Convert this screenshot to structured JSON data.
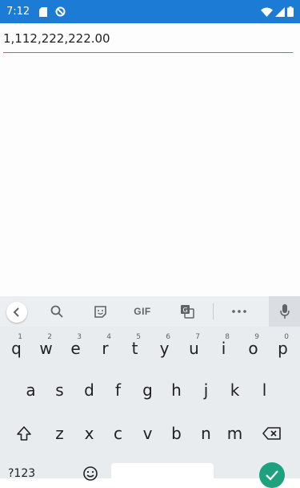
{
  "status_bar": {
    "time": "7:12",
    "bg_color": "#1c7bd4",
    "icons": [
      "sd-card-icon",
      "data-saver-icon",
      "wifi-icon",
      "signal-icon",
      "battery-icon"
    ]
  },
  "text_field": {
    "value": "1,112,222,222.00",
    "underline_color": "#e8457b"
  },
  "keyboard": {
    "suggestion_bar": {
      "gif_label": "GIF",
      "items": [
        "back-icon",
        "search-icon",
        "sticker-icon",
        "gif",
        "translate-icon",
        "more-icon",
        "mic-icon"
      ]
    },
    "row1": [
      {
        "k": "q",
        "h": "1"
      },
      {
        "k": "w",
        "h": "2"
      },
      {
        "k": "e",
        "h": "3"
      },
      {
        "k": "r",
        "h": "4"
      },
      {
        "k": "t",
        "h": "5"
      },
      {
        "k": "y",
        "h": "6"
      },
      {
        "k": "u",
        "h": "7"
      },
      {
        "k": "i",
        "h": "8"
      },
      {
        "k": "o",
        "h": "9"
      },
      {
        "k": "p",
        "h": "0"
      }
    ],
    "row2": [
      "a",
      "s",
      "d",
      "f",
      "g",
      "h",
      "j",
      "k",
      "l"
    ],
    "row3": [
      "z",
      "x",
      "c",
      "v",
      "b",
      "n",
      "m"
    ],
    "symbols_label": "?123",
    "enter_color": "#1ea27e"
  }
}
